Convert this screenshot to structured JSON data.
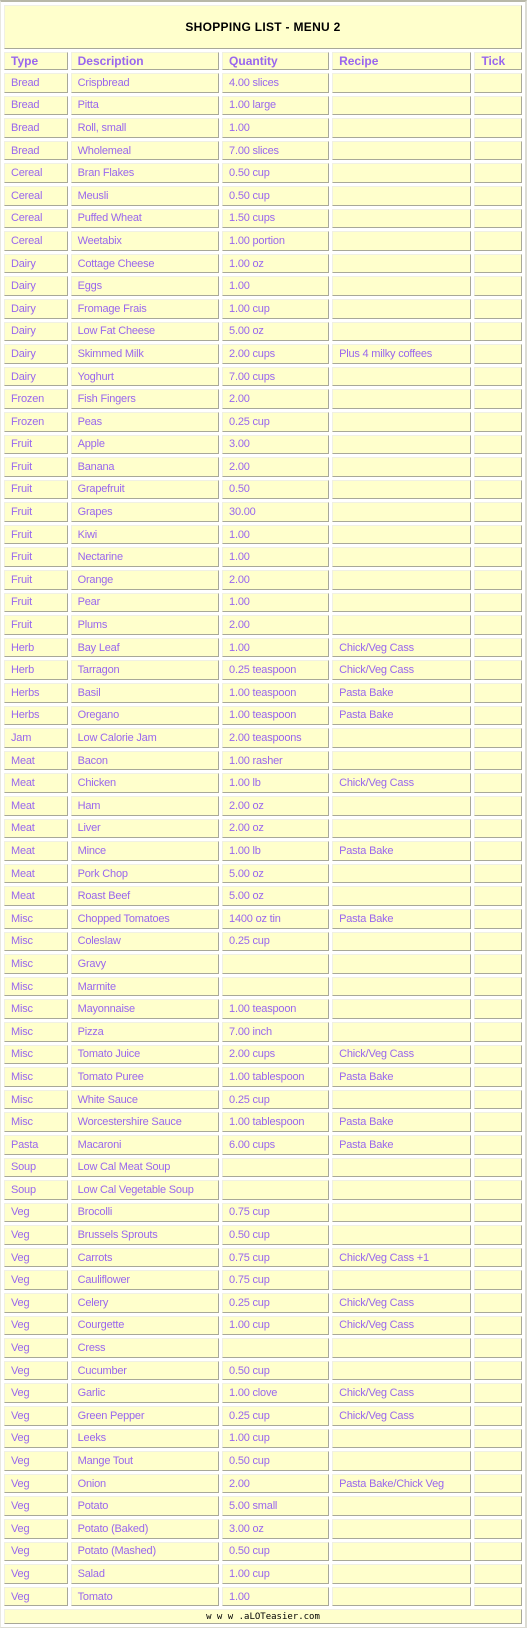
{
  "title": "SHOPPING LIST - MENU 2",
  "columns": [
    "Type",
    "Description",
    "Quantity",
    "Recipe",
    "Tick"
  ],
  "rows": [
    {
      "type": "Bread",
      "description": "Crispbread",
      "quantity": "4.00 slices",
      "recipe": "",
      "tick": ""
    },
    {
      "type": "Bread",
      "description": "Pitta",
      "quantity": "1.00 large",
      "recipe": "",
      "tick": ""
    },
    {
      "type": "Bread",
      "description": "Roll, small",
      "quantity": "1.00",
      "recipe": "",
      "tick": ""
    },
    {
      "type": "Bread",
      "description": "Wholemeal",
      "quantity": "7.00 slices",
      "recipe": "",
      "tick": ""
    },
    {
      "type": "Cereal",
      "description": "Bran Flakes",
      "quantity": "0.50 cup",
      "recipe": "",
      "tick": ""
    },
    {
      "type": "Cereal",
      "description": "Meusli",
      "quantity": "0.50 cup",
      "recipe": "",
      "tick": ""
    },
    {
      "type": "Cereal",
      "description": "Puffed Wheat",
      "quantity": "1.50 cups",
      "recipe": "",
      "tick": ""
    },
    {
      "type": "Cereal",
      "description": "Weetabix",
      "quantity": "1.00 portion",
      "recipe": "",
      "tick": ""
    },
    {
      "type": "Dairy",
      "description": "Cottage Cheese",
      "quantity": "1.00 oz",
      "recipe": "",
      "tick": ""
    },
    {
      "type": "Dairy",
      "description": "Eggs",
      "quantity": "1.00",
      "recipe": "",
      "tick": ""
    },
    {
      "type": "Dairy",
      "description": "Fromage Frais",
      "quantity": "1.00 cup",
      "recipe": "",
      "tick": ""
    },
    {
      "type": "Dairy",
      "description": "Low Fat Cheese",
      "quantity": "5.00 oz",
      "recipe": "",
      "tick": ""
    },
    {
      "type": "Dairy",
      "description": "Skimmed Milk",
      "quantity": "2.00 cups",
      "recipe": "Plus 4 milky coffees",
      "tick": ""
    },
    {
      "type": "Dairy",
      "description": "Yoghurt",
      "quantity": "7.00 cups",
      "recipe": "",
      "tick": ""
    },
    {
      "type": "Frozen",
      "description": "Fish Fingers",
      "quantity": "2.00",
      "recipe": "",
      "tick": ""
    },
    {
      "type": "Frozen",
      "description": "Peas",
      "quantity": "0.25 cup",
      "recipe": "",
      "tick": ""
    },
    {
      "type": "Fruit",
      "description": "Apple",
      "quantity": "3.00",
      "recipe": "",
      "tick": ""
    },
    {
      "type": "Fruit",
      "description": "Banana",
      "quantity": "2.00",
      "recipe": "",
      "tick": ""
    },
    {
      "type": "Fruit",
      "description": "Grapefruit",
      "quantity": "0.50",
      "recipe": "",
      "tick": ""
    },
    {
      "type": "Fruit",
      "description": "Grapes",
      "quantity": "30.00",
      "recipe": "",
      "tick": ""
    },
    {
      "type": "Fruit",
      "description": "Kiwi",
      "quantity": "1.00",
      "recipe": "",
      "tick": ""
    },
    {
      "type": "Fruit",
      "description": "Nectarine",
      "quantity": "1.00",
      "recipe": "",
      "tick": ""
    },
    {
      "type": "Fruit",
      "description": "Orange",
      "quantity": "2.00",
      "recipe": "",
      "tick": ""
    },
    {
      "type": "Fruit",
      "description": "Pear",
      "quantity": "1.00",
      "recipe": "",
      "tick": ""
    },
    {
      "type": "Fruit",
      "description": "Plums",
      "quantity": "2.00",
      "recipe": "",
      "tick": ""
    },
    {
      "type": "Herb",
      "description": "Bay Leaf",
      "quantity": "1.00",
      "recipe": "Chick/Veg Cass",
      "tick": ""
    },
    {
      "type": "Herb",
      "description": "Tarragon",
      "quantity": "0.25 teaspoon",
      "recipe": "Chick/Veg Cass",
      "tick": ""
    },
    {
      "type": "Herbs",
      "description": "Basil",
      "quantity": "1.00 teaspoon",
      "recipe": "Pasta Bake",
      "tick": ""
    },
    {
      "type": "Herbs",
      "description": "Oregano",
      "quantity": "1.00 teaspoon",
      "recipe": "Pasta Bake",
      "tick": ""
    },
    {
      "type": "Jam",
      "description": "Low Calorie Jam",
      "quantity": "2.00 teaspoons",
      "recipe": "",
      "tick": ""
    },
    {
      "type": "Meat",
      "description": "Bacon",
      "quantity": "1.00 rasher",
      "recipe": "",
      "tick": ""
    },
    {
      "type": "Meat",
      "description": "Chicken",
      "quantity": "1.00 lb",
      "recipe": "Chick/Veg Cass",
      "tick": ""
    },
    {
      "type": "Meat",
      "description": "Ham",
      "quantity": "2.00 oz",
      "recipe": "",
      "tick": ""
    },
    {
      "type": "Meat",
      "description": "Liver",
      "quantity": "2.00 oz",
      "recipe": "",
      "tick": ""
    },
    {
      "type": "Meat",
      "description": "Mince",
      "quantity": "1.00 lb",
      "recipe": "Pasta Bake",
      "tick": ""
    },
    {
      "type": "Meat",
      "description": "Pork Chop",
      "quantity": "5.00 oz",
      "recipe": "",
      "tick": ""
    },
    {
      "type": "Meat",
      "description": "Roast Beef",
      "quantity": "5.00 oz",
      "recipe": "",
      "tick": ""
    },
    {
      "type": "Misc",
      "description": "Chopped Tomatoes",
      "quantity": "1400 oz tin",
      "recipe": "Pasta Bake",
      "tick": ""
    },
    {
      "type": "Misc",
      "description": "Coleslaw",
      "quantity": "0.25 cup",
      "recipe": "",
      "tick": ""
    },
    {
      "type": "Misc",
      "description": "Gravy",
      "quantity": "",
      "recipe": "",
      "tick": ""
    },
    {
      "type": "Misc",
      "description": "Marmite",
      "quantity": "",
      "recipe": "",
      "tick": ""
    },
    {
      "type": "Misc",
      "description": "Mayonnaise",
      "quantity": "1.00 teaspoon",
      "recipe": "",
      "tick": ""
    },
    {
      "type": "Misc",
      "description": "Pizza",
      "quantity": "7.00 inch",
      "recipe": "",
      "tick": ""
    },
    {
      "type": "Misc",
      "description": "Tomato Juice",
      "quantity": "2.00 cups",
      "recipe": "Chick/Veg Cass",
      "tick": ""
    },
    {
      "type": "Misc",
      "description": "Tomato Puree",
      "quantity": "1.00 tablespoon",
      "recipe": "Pasta Bake",
      "tick": ""
    },
    {
      "type": "Misc",
      "description": "White Sauce",
      "quantity": "0.25 cup",
      "recipe": "",
      "tick": ""
    },
    {
      "type": "Misc",
      "description": "Worcestershire Sauce",
      "quantity": "1.00 tablespoon",
      "recipe": "Pasta Bake",
      "tick": ""
    },
    {
      "type": "Pasta",
      "description": "Macaroni",
      "quantity": "6.00 cups",
      "recipe": "Pasta Bake",
      "tick": ""
    },
    {
      "type": "Soup",
      "description": "Low Cal Meat Soup",
      "quantity": "",
      "recipe": "",
      "tick": ""
    },
    {
      "type": "Soup",
      "description": "Low Cal Vegetable Soup",
      "quantity": "",
      "recipe": "",
      "tick": ""
    },
    {
      "type": "Veg",
      "description": "Brocolli",
      "quantity": "0.75 cup",
      "recipe": "",
      "tick": ""
    },
    {
      "type": "Veg",
      "description": "Brussels Sprouts",
      "quantity": "0.50 cup",
      "recipe": "",
      "tick": ""
    },
    {
      "type": "Veg",
      "description": "Carrots",
      "quantity": "0.75 cup",
      "recipe": "Chick/Veg Cass +1",
      "tick": ""
    },
    {
      "type": "Veg",
      "description": "Cauliflower",
      "quantity": "0.75 cup",
      "recipe": "",
      "tick": ""
    },
    {
      "type": "Veg",
      "description": "Celery",
      "quantity": "0.25 cup",
      "recipe": "Chick/Veg Cass",
      "tick": ""
    },
    {
      "type": "Veg",
      "description": "Courgette",
      "quantity": "1.00 cup",
      "recipe": "Chick/Veg Cass",
      "tick": ""
    },
    {
      "type": "Veg",
      "description": "Cress",
      "quantity": "",
      "recipe": "",
      "tick": ""
    },
    {
      "type": "Veg",
      "description": "Cucumber",
      "quantity": "0.50 cup",
      "recipe": "",
      "tick": ""
    },
    {
      "type": "Veg",
      "description": "Garlic",
      "quantity": "1.00 clove",
      "recipe": "Chick/Veg Cass",
      "tick": ""
    },
    {
      "type": "Veg",
      "description": "Green Pepper",
      "quantity": "0.25 cup",
      "recipe": "Chick/Veg Cass",
      "tick": ""
    },
    {
      "type": "Veg",
      "description": "Leeks",
      "quantity": "1.00 cup",
      "recipe": "",
      "tick": ""
    },
    {
      "type": "Veg",
      "description": "Mange Tout",
      "quantity": "0.50 cup",
      "recipe": "",
      "tick": ""
    },
    {
      "type": "Veg",
      "description": "Onion",
      "quantity": "2.00",
      "recipe": "Pasta Bake/Chick Veg",
      "tick": ""
    },
    {
      "type": "Veg",
      "description": "Potato",
      "quantity": "5.00 small",
      "recipe": "",
      "tick": ""
    },
    {
      "type": "Veg",
      "description": "Potato (Baked)",
      "quantity": "3.00 oz",
      "recipe": "",
      "tick": ""
    },
    {
      "type": "Veg",
      "description": "Potato (Mashed)",
      "quantity": "0.50 cup",
      "recipe": "",
      "tick": ""
    },
    {
      "type": "Veg",
      "description": "Salad",
      "quantity": "1.00 cup",
      "recipe": "",
      "tick": ""
    },
    {
      "type": "Veg",
      "description": "Tomato",
      "quantity": "1.00",
      "recipe": "",
      "tick": ""
    }
  ],
  "footer": "www.aLOTeasier.com",
  "colors": {
    "cell_background": "#ffffcc",
    "text_accent": "#9966ee",
    "title_text": "#000000"
  }
}
